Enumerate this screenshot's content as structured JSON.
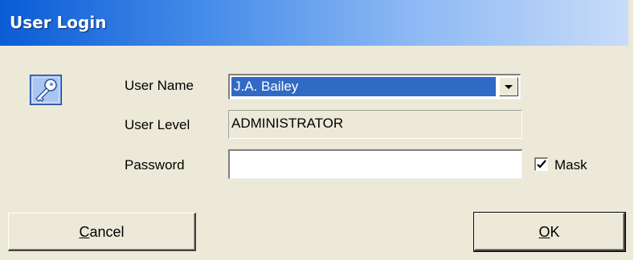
{
  "window": {
    "title": "User Login"
  },
  "icons": {
    "app_icon": "key-icon",
    "checkmark": "checkmark-icon",
    "dropdown": "triangle-down-icon"
  },
  "form": {
    "user_name_label": "User Name",
    "user_name_value": "J.A. Bailey",
    "user_level_label": "User Level",
    "user_level_value": "ADMINISTRATOR",
    "password_label": "Password",
    "password_value": "",
    "mask_label": "Mask",
    "mask_checked": true
  },
  "buttons": {
    "cancel_label": "Cancel",
    "ok_label": "OK"
  },
  "colors": {
    "title_bar": "#0a5cd6",
    "selection": "#316ac5",
    "window_bg": "#ece9d8"
  }
}
